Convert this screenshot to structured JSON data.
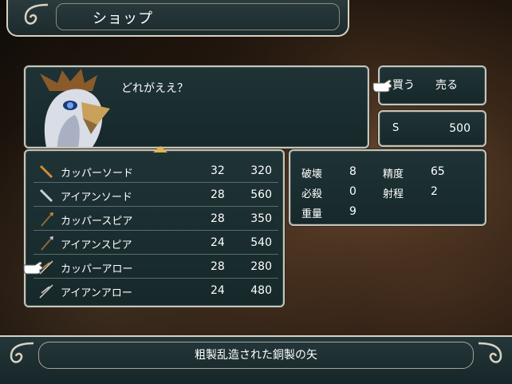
{
  "screen": {
    "title": "ショップ"
  },
  "dialog": {
    "text": "どれがええ？"
  },
  "actions": {
    "buy": "買う",
    "sell": "売る"
  },
  "gold": {
    "label": "S",
    "value": "500"
  },
  "items": [
    {
      "name": "カッパーソード",
      "durability": "32",
      "price": "320",
      "icon": "copper-sword-icon",
      "color": "#d18a3a"
    },
    {
      "name": "アイアンソード",
      "durability": "28",
      "price": "560",
      "icon": "iron-sword-icon",
      "color": "#c8cfd6"
    },
    {
      "name": "カッパースピア",
      "durability": "28",
      "price": "350",
      "icon": "copper-spear-icon",
      "color": "#d18a3a"
    },
    {
      "name": "アイアンスピア",
      "durability": "24",
      "price": "540",
      "icon": "iron-spear-icon",
      "color": "#c8cfd6"
    },
    {
      "name": "カッパーアロー",
      "durability": "28",
      "price": "280",
      "icon": "copper-arrow-icon",
      "color": "#d18a3a"
    },
    {
      "name": "アイアンアロー",
      "durability": "24",
      "price": "480",
      "icon": "iron-arrow-icon",
      "color": "#c8cfd6"
    }
  ],
  "selected_index": 4,
  "stats": {
    "destroy_label": "破壊",
    "destroy": "8",
    "accuracy_label": "精度",
    "accuracy": "65",
    "critical_label": "必殺",
    "critical": "0",
    "range_label": "射程",
    "range": "2",
    "weight_label": "重量",
    "weight": "9"
  },
  "description": {
    "text": "粗製乱造された銅製の矢"
  },
  "colors": {
    "panel": "#1f3336",
    "border": "#c9c4b4",
    "accent": "#e0b64a"
  }
}
